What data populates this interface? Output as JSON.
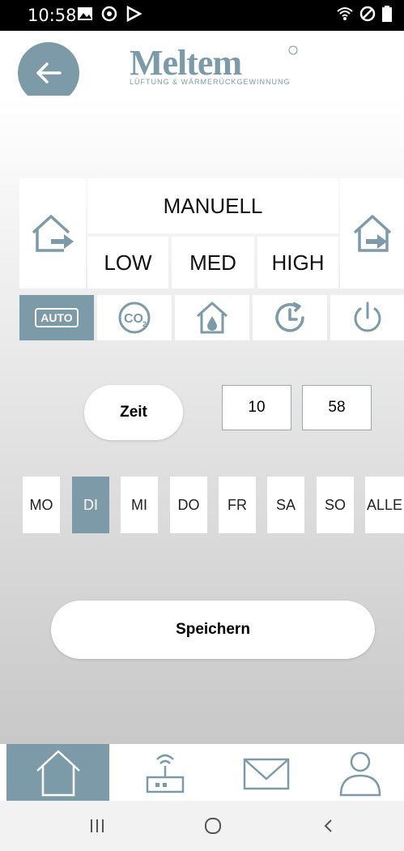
{
  "status_bar": {
    "time": "10:58",
    "left_icons": [
      "image-icon",
      "sync-icon",
      "play-store-icon"
    ],
    "right_icons": [
      "wifi-icon",
      "no-signal-icon",
      "battery-icon"
    ]
  },
  "header": {
    "logo_text": "Meltem",
    "logo_subtitle": "LÜFTUNG & WÄRMERÜCKGEWINNUNG"
  },
  "mode_panel": {
    "mode_label": "MANUELL",
    "levels": [
      "LOW",
      "MED",
      "HIGH"
    ],
    "left_icon": "house-exhaust-icon",
    "right_icon": "house-supply-icon"
  },
  "function_buttons": [
    {
      "name": "auto",
      "label": "AUTO",
      "active": true
    },
    {
      "name": "co2",
      "label": "CO2",
      "active": false
    },
    {
      "name": "humidity",
      "active": false
    },
    {
      "name": "timer",
      "active": false
    },
    {
      "name": "power",
      "active": false
    }
  ],
  "time_settings": {
    "zeit_label": "Zeit",
    "hour": "10",
    "minute": "58"
  },
  "days": [
    "MO",
    "DI",
    "MI",
    "DO",
    "FR",
    "SA",
    "SO",
    "ALLE"
  ],
  "active_day": "DI",
  "save_label": "Speichern",
  "bottom_nav": [
    "home-icon",
    "router-icon",
    "mail-icon",
    "user-icon"
  ],
  "colors": {
    "accent": "#7d9aa8",
    "background_top": "#ffffff",
    "background_bottom": "#c8c8c8"
  }
}
